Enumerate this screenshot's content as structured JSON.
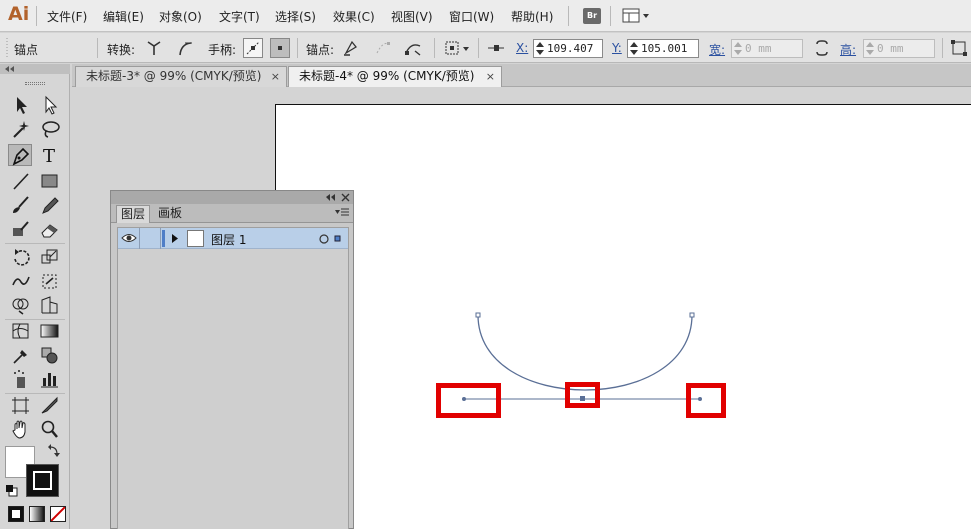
{
  "app": {
    "logo": "Ai",
    "bridge_label": "Br"
  },
  "menu": [
    "文件(F)",
    "编辑(E)",
    "对象(O)",
    "文字(T)",
    "选择(S)",
    "效果(C)",
    "视图(V)",
    "窗口(W)",
    "帮助(H)"
  ],
  "control_bar": {
    "mode_label": "锚点",
    "convert_label": "转换:",
    "handles_label": "手柄:",
    "anchors_label": "锚点:",
    "x_label": "X:",
    "x_value": "109.407",
    "y_label": "Y:",
    "y_value": "105.001",
    "width_label": "宽:",
    "width_value": "0 mm",
    "height_label": "高:",
    "height_value": "0 mm"
  },
  "tabs": [
    {
      "label": "未标题-3* @ 99% (CMYK/预览)",
      "close": "×",
      "active": false
    },
    {
      "label": "未标题-4* @ 99% (CMYK/预览)",
      "close": "×",
      "active": true
    }
  ],
  "layers_panel": {
    "tabs": [
      "图层",
      "画板"
    ],
    "layers": [
      {
        "name": "图层 1"
      }
    ]
  },
  "colors": {
    "highlight_box": "#e10000",
    "path_stroke": "#5a6f96",
    "layer_row_bg": "#b9cfe8",
    "layer_color_bar": "#4f7ec7"
  },
  "icons": [
    "pen-tool-icon",
    "selection-tool-icon",
    "type-tool-icon",
    "eye-icon",
    "expand-triangle-icon",
    "target-circle-icon",
    "panel-menu-icon",
    "close-icon"
  ]
}
